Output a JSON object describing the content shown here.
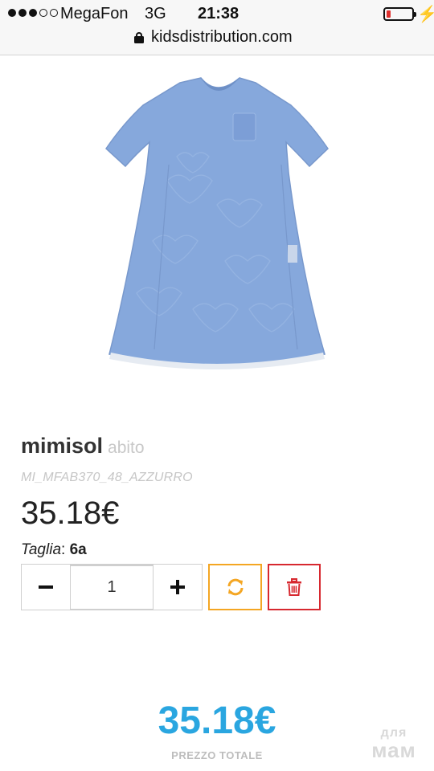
{
  "status_bar": {
    "carrier": "MegaFon",
    "network": "3G",
    "time": "21:38",
    "battery_level": 0.15,
    "battery_color": "#e0302e",
    "charging_icon": "bolt-icon",
    "lock_icon": "lock-icon"
  },
  "browser": {
    "url": "kidsdistribution.com"
  },
  "product": {
    "brand": "mimisol",
    "category": "abito",
    "sku": "MI_MFAB370_48_AZZURRO",
    "price": "35.18€",
    "size_label": "Taglia",
    "size_separator": ": ",
    "size_value": "6a",
    "image_icon": "blue-dress-image"
  },
  "quantity": {
    "minus_icon": "minus-icon",
    "value": "1",
    "plus_icon": "plus-icon"
  },
  "actions": {
    "refresh_icon": "refresh-icon",
    "refresh_color": "#f4a623",
    "delete_icon": "trash-icon",
    "delete_color": "#d7282f"
  },
  "summary": {
    "total": "35.18€",
    "total_label": "PREZZO TOTALE",
    "total_color": "#2aa6e0"
  },
  "watermark": {
    "line1": "для",
    "line2": "мам"
  }
}
